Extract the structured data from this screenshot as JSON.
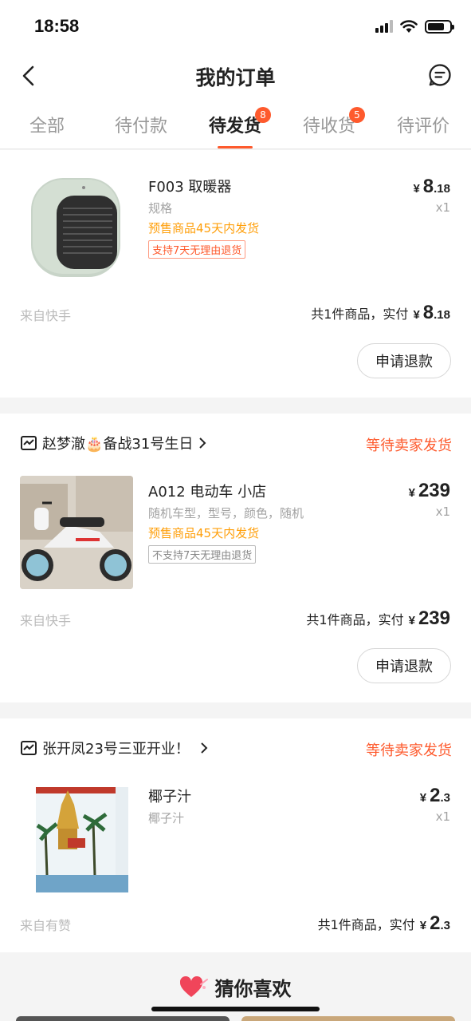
{
  "status_bar": {
    "time": "18:58"
  },
  "nav": {
    "title": "我的订单"
  },
  "tabs": [
    {
      "label": "全部",
      "badge": ""
    },
    {
      "label": "待付款",
      "badge": ""
    },
    {
      "label": "待发货",
      "badge": "8"
    },
    {
      "label": "待收货",
      "badge": "5"
    },
    {
      "label": "待评价",
      "badge": ""
    }
  ],
  "orders": [
    {
      "shop": "",
      "status": "",
      "product": "F003 取暖器",
      "spec": "规格",
      "presale": "预售商品45天内发货",
      "tag": "支持7天无理由退货",
      "price_symbol": "¥",
      "price_int": "8",
      "price_dec": ".18",
      "qty": "x1",
      "source": "来自快手",
      "summary_text": "共1件商品，实付",
      "refund_label": "申请退款"
    },
    {
      "shop": "赵梦澈🎂备战31号生日",
      "status": "等待卖家发货",
      "product": "A012 电动车 小店",
      "spec": "随机车型，型号，颜色，随机",
      "presale": "预售商品45天内发货",
      "tag": "不支持7天无理由退货",
      "price_symbol": "¥",
      "price_int": "239",
      "price_dec": "",
      "qty": "x1",
      "source": "来自快手",
      "summary_text": "共1件商品，实付",
      "refund_label": "申请退款"
    },
    {
      "shop": "张开凤23号三亚开业！",
      "status": "等待卖家发货",
      "product": "椰子汁",
      "spec": "椰子汁",
      "presale": "",
      "tag": "",
      "price_symbol": "¥",
      "price_int": "2",
      "price_dec": ".3",
      "qty": "x1",
      "source": "来自有赞",
      "summary_text": "共1件商品，实付",
      "refund_label": ""
    }
  ],
  "recommend": {
    "title": "猜你喜欢"
  },
  "colors": {
    "accent": "#fe5a2d",
    "presale": "#ff9f0a",
    "muted": "#a3a3a3"
  }
}
